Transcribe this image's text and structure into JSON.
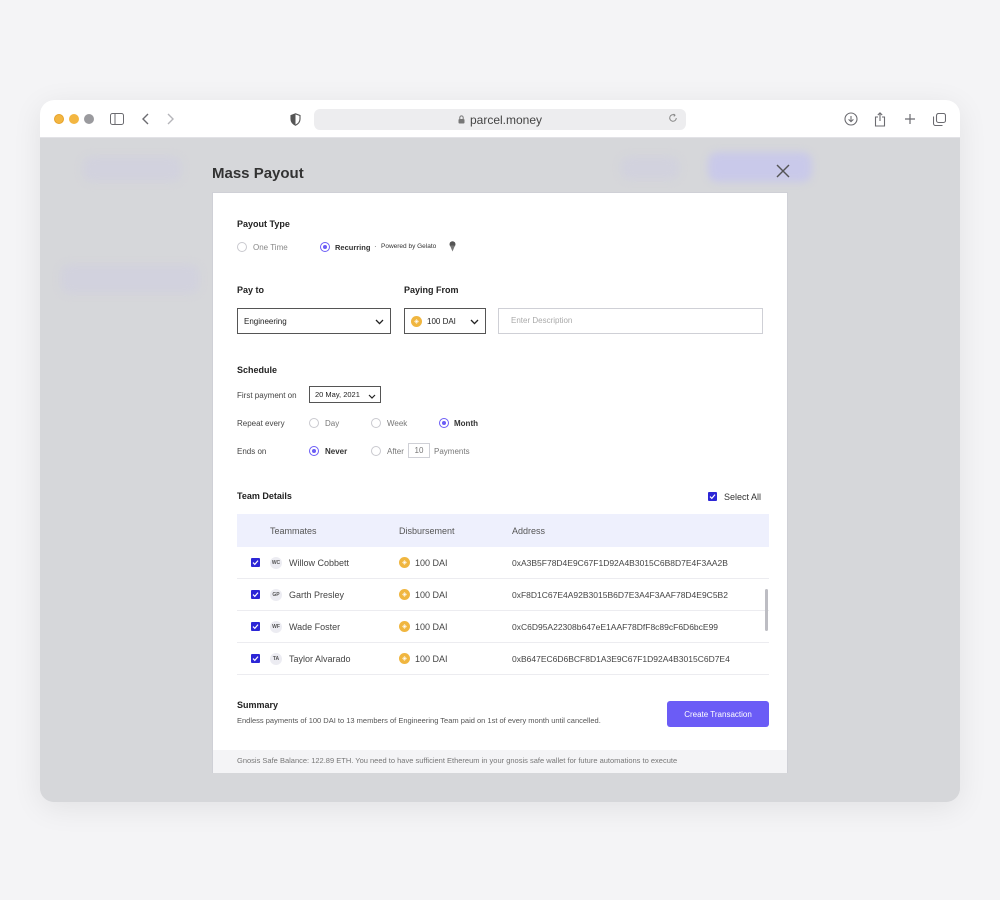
{
  "browser": {
    "url": "parcel.money"
  },
  "modal": {
    "title": "Mass Payout",
    "payout_type": {
      "label": "Payout Type",
      "options": [
        "One Time",
        "Recurring"
      ],
      "selected": "Recurring",
      "powered_sep": "·",
      "powered_by": "Powered by Gelato"
    },
    "pay_to": {
      "label": "Pay to",
      "value": "Engineering"
    },
    "paying_from": {
      "label": "Paying From",
      "value": "100 DAI"
    },
    "description": {
      "placeholder": "Enter Description"
    },
    "schedule": {
      "label": "Schedule",
      "first_payment_label": "First payment on",
      "first_payment_value": "20 May, 2021",
      "repeat_label": "Repeat every",
      "repeat_options": [
        "Day",
        "Week",
        "Month"
      ],
      "repeat_selected": "Month",
      "ends_label": "Ends on",
      "ends_never": "Never",
      "ends_after": "After",
      "ends_after_count": "10",
      "ends_payments": "Payments"
    },
    "team": {
      "label": "Team Details",
      "select_all": "Select All",
      "columns": [
        "Teammates",
        "Disbursement",
        "Address"
      ],
      "rows": [
        {
          "initials": "WC",
          "name": "Willow Cobbett",
          "amount": "100 DAI",
          "address": "0xA3B5F78D4E9C67F1D92A4B3015C6B8D7E4F3AA2B"
        },
        {
          "initials": "GP",
          "name": "Garth Presley",
          "amount": "100 DAI",
          "address": "0xF8D1C67E4A92B3015B6D7E3A4F3AAF78D4E9C5B2"
        },
        {
          "initials": "WF",
          "name": "Wade Foster",
          "amount": "100 DAI",
          "address": "0xC6D95A22308b647eE1AAF78DfF8c89cF6D6bcE99"
        },
        {
          "initials": "TA",
          "name": "Taylor Alvarado",
          "amount": "100 DAI",
          "address": "0xB647EC6D6BCF8D1A3E9C67F1D92A4B3015C6D7E4"
        }
      ]
    },
    "summary": {
      "label": "Summary",
      "text": "Endless payments of 100 DAI to 13 members of Engineering Team paid on 1st of every month until cancelled."
    },
    "create_button": "Create Transaction",
    "footer": "Gnosis Safe Balance: 122.89 ETH. You need to have sufficient Ethereum in your gnosis safe wallet for future automations to execute"
  },
  "colors": {
    "accent": "#6b5cf6",
    "checkbox": "#2c26d6",
    "coin": "#f0b640",
    "table_header_bg": "#eef0fd"
  }
}
